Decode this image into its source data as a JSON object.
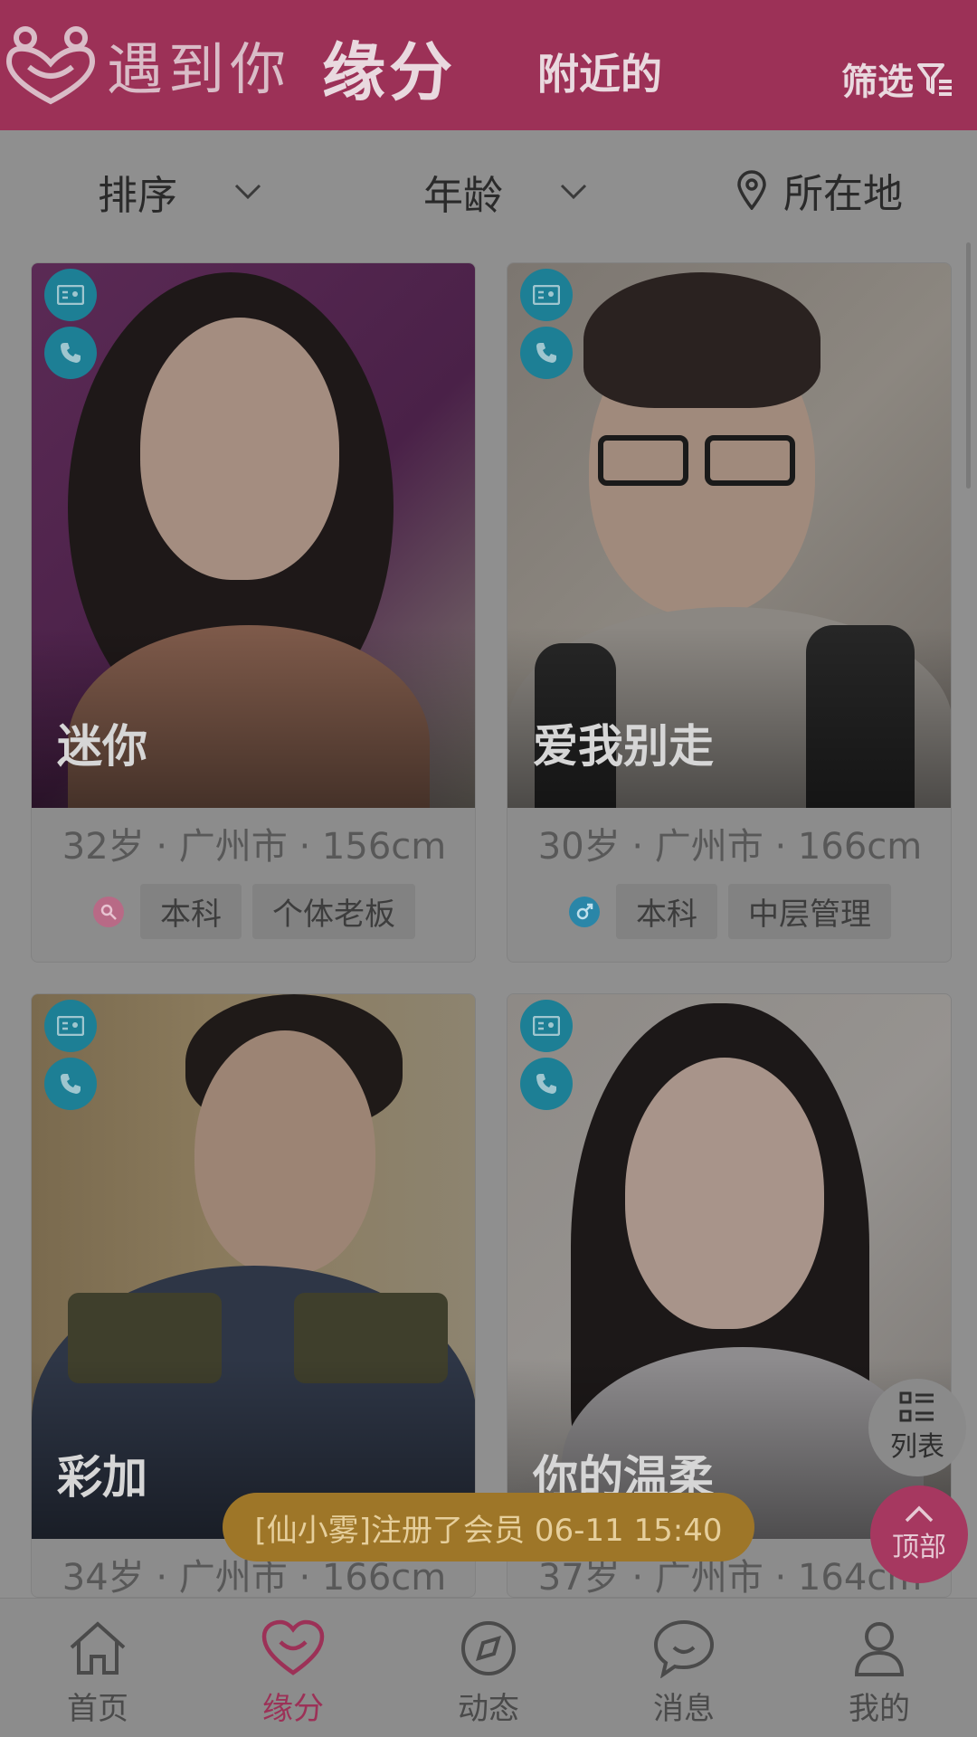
{
  "header": {
    "brand": "遇到你",
    "tab_active": "缘分",
    "tab_nearby": "附近的",
    "filter_label": "筛选",
    "brand_color": "#9c3157"
  },
  "sortbar": {
    "sort_label": "排序",
    "age_label": "年龄",
    "location_label": "所在地"
  },
  "cards": [
    {
      "name": "迷你",
      "info": "32岁 · 广州市 · 156cm",
      "gender": "female",
      "tags": [
        "本科",
        "个体老板"
      ]
    },
    {
      "name": "爱我别走",
      "info": "30岁 · 广州市 · 166cm",
      "gender": "male",
      "tags": [
        "本科",
        "中层管理"
      ]
    },
    {
      "name": "彩加",
      "info": "34岁 · 广州市 · 166cm",
      "gender": "male",
      "tags": []
    },
    {
      "name": "你的温柔",
      "info": "37岁 · 广州市 · 164cm",
      "gender": "female",
      "tags": []
    }
  ],
  "floating": {
    "list_label": "列表",
    "top_label": "顶部"
  },
  "toast": "[仙小雾]注册了会员 06-11 15:40",
  "nav": [
    {
      "label": "首页",
      "icon": "home-icon"
    },
    {
      "label": "缘分",
      "icon": "heart-icon"
    },
    {
      "label": "动态",
      "icon": "compass-icon"
    },
    {
      "label": "消息",
      "icon": "message-icon"
    },
    {
      "label": "我的",
      "icon": "user-icon"
    }
  ]
}
